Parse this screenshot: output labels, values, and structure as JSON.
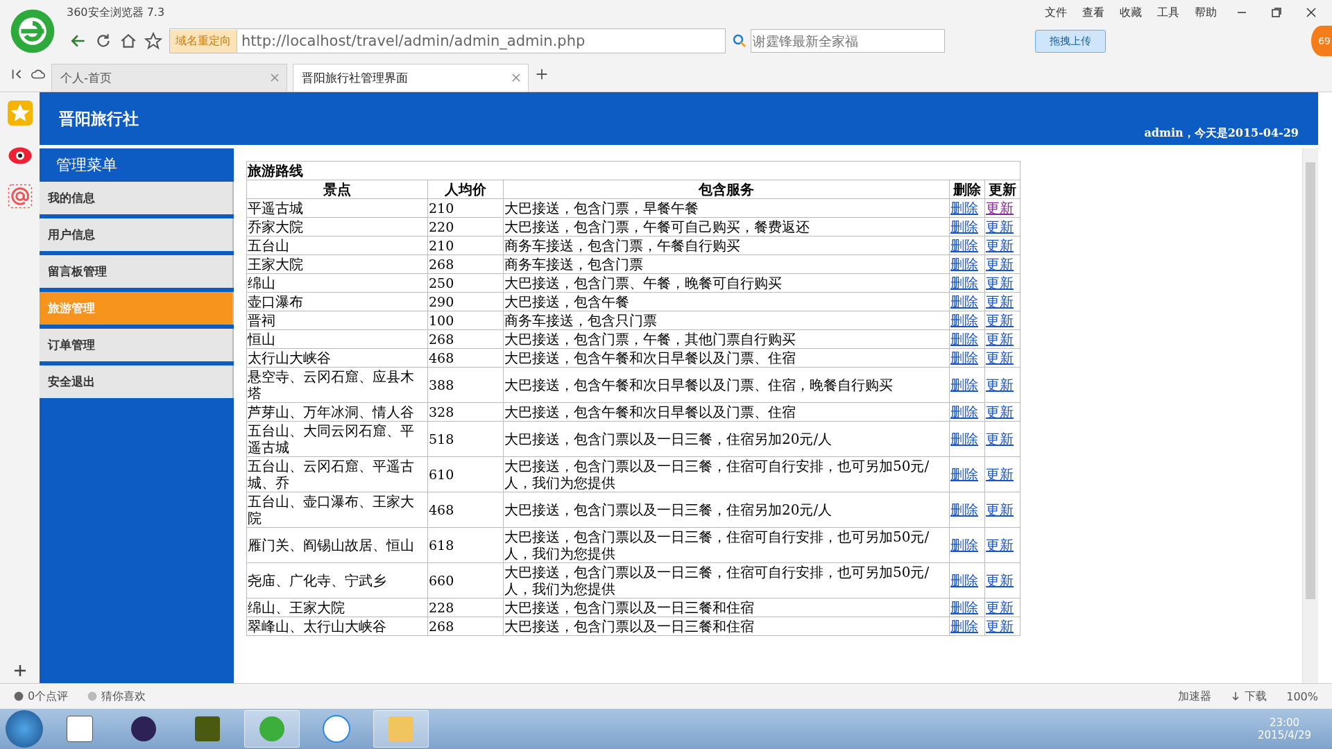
{
  "browser": {
    "title": "360安全浏览器 7.3",
    "menu": [
      "文件",
      "查看",
      "收藏",
      "工具",
      "帮助"
    ],
    "redirect_badge": "域名重定向",
    "url": "http://localhost/travel/admin/admin_admin.php",
    "search": {
      "placeholder": "谢霆锋最新全家福"
    },
    "upload_button": "拖拽上传",
    "badge": "69",
    "tabs": [
      {
        "label": "个人-首页",
        "selected": false
      },
      {
        "label": "晋阳旅行社管理界面",
        "selected": true
      }
    ]
  },
  "header": {
    "title": "晋阳旅行社",
    "greeting": "admin，今天是2015-04-29"
  },
  "sidebar": {
    "title": "管理菜单",
    "items": [
      {
        "label": "我的信息",
        "selected": false
      },
      {
        "label": "用户信息",
        "selected": false
      },
      {
        "label": "留言板管理",
        "selected": false
      },
      {
        "label": "旅游管理",
        "selected": true
      },
      {
        "label": "订单管理",
        "selected": false
      },
      {
        "label": "安全退出",
        "selected": false
      }
    ]
  },
  "table": {
    "caption": "旅游路线",
    "columns": [
      "景点",
      "人均价",
      "包含服务",
      "删除",
      "更新"
    ],
    "rows": [
      {
        "place": "平遥古城",
        "price": "210",
        "service": "大巴接送，包含门票，早餐午餐",
        "delete": "删除",
        "update": "更新",
        "visited": true
      },
      {
        "place": "乔家大院",
        "price": "220",
        "service": "大巴接送，包含门票，午餐可自己购买，餐费返还",
        "delete": "删除",
        "update": "更新",
        "visited": false
      },
      {
        "place": "五台山",
        "price": "210",
        "service": "商务车接送，包含门票，午餐自行购买",
        "delete": "删除",
        "update": "更新",
        "visited": false
      },
      {
        "place": "王家大院",
        "price": "268",
        "service": "商务车接送，包含门票",
        "delete": "删除",
        "update": "更新",
        "visited": false
      },
      {
        "place": "绵山",
        "price": "250",
        "service": "大巴接送，包含门票、午餐，晚餐可自行购买",
        "delete": "删除",
        "update": "更新",
        "visited": false
      },
      {
        "place": "壶口瀑布",
        "price": "290",
        "service": "大巴接送，包含午餐",
        "delete": "删除",
        "update": "更新",
        "visited": false
      },
      {
        "place": "晋祠",
        "price": "100",
        "service": "商务车接送，包含只门票",
        "delete": "删除",
        "update": "更新",
        "visited": false
      },
      {
        "place": "恒山",
        "price": "268",
        "service": "大巴接送，包含门票，午餐，其他门票自行购买",
        "delete": "删除",
        "update": "更新",
        "visited": false
      },
      {
        "place": "太行山大峡谷",
        "price": "468",
        "service": "大巴接送，包含午餐和次日早餐以及门票、住宿",
        "delete": "删除",
        "update": "更新",
        "visited": false
      },
      {
        "place": "悬空寺、云冈石窟、应县木塔",
        "price": "388",
        "service": "大巴接送，包含午餐和次日早餐以及门票、住宿，晚餐自行购买",
        "delete": "删除",
        "update": "更新",
        "visited": false
      },
      {
        "place": "芦芽山、万年冰洞、情人谷",
        "price": "328",
        "service": "大巴接送，包含午餐和次日早餐以及门票、住宿",
        "delete": "删除",
        "update": "更新",
        "visited": false
      },
      {
        "place": "五台山、大同云冈石窟、平遥古城",
        "price": "518",
        "service": "大巴接送，包含门票以及一日三餐，住宿另加20元/人",
        "delete": "删除",
        "update": "更新",
        "visited": false
      },
      {
        "place": "五台山、云冈石窟、平遥古城、乔",
        "price": "610",
        "service": "大巴接送，包含门票以及一日三餐，住宿可自行安排，也可另加50元/人，我们为您提供",
        "delete": "删除",
        "update": "更新",
        "visited": false
      },
      {
        "place": "五台山、壶口瀑布、王家大院",
        "price": "468",
        "service": "大巴接送，包含门票以及一日三餐，住宿另加20元/人",
        "delete": "删除",
        "update": "更新",
        "visited": false
      },
      {
        "place": "雁门关、阎锡山故居、恒山",
        "price": "618",
        "service": "大巴接送，包含门票以及一日三餐，住宿可自行安排，也可另加50元/人，我们为您提供",
        "delete": "删除",
        "update": "更新",
        "visited": false
      },
      {
        "place": "尧庙、广化寺、宁武乡",
        "price": "660",
        "service": "大巴接送，包含门票以及一日三餐，住宿可自行安排，也可另加50元/人，我们为您提供",
        "delete": "删除",
        "update": "更新",
        "visited": false
      },
      {
        "place": "绵山、王家大院",
        "price": "228",
        "service": "大巴接送，包含门票以及一日三餐和住宿",
        "delete": "删除",
        "update": "更新",
        "visited": false
      },
      {
        "place": "翠峰山、太行山大峡谷",
        "price": "268",
        "service": "大巴接送，包含门票以及一日三餐和住宿",
        "delete": "删除",
        "update": "更新",
        "visited": false
      }
    ]
  },
  "status_bar": {
    "reviews": "0个点评",
    "guess": "猜你喜欢",
    "accelerator": "加速器",
    "download": "下载",
    "zoom": "100%"
  },
  "taskbar": {
    "time": "23:00",
    "date": "2015/4/29"
  }
}
